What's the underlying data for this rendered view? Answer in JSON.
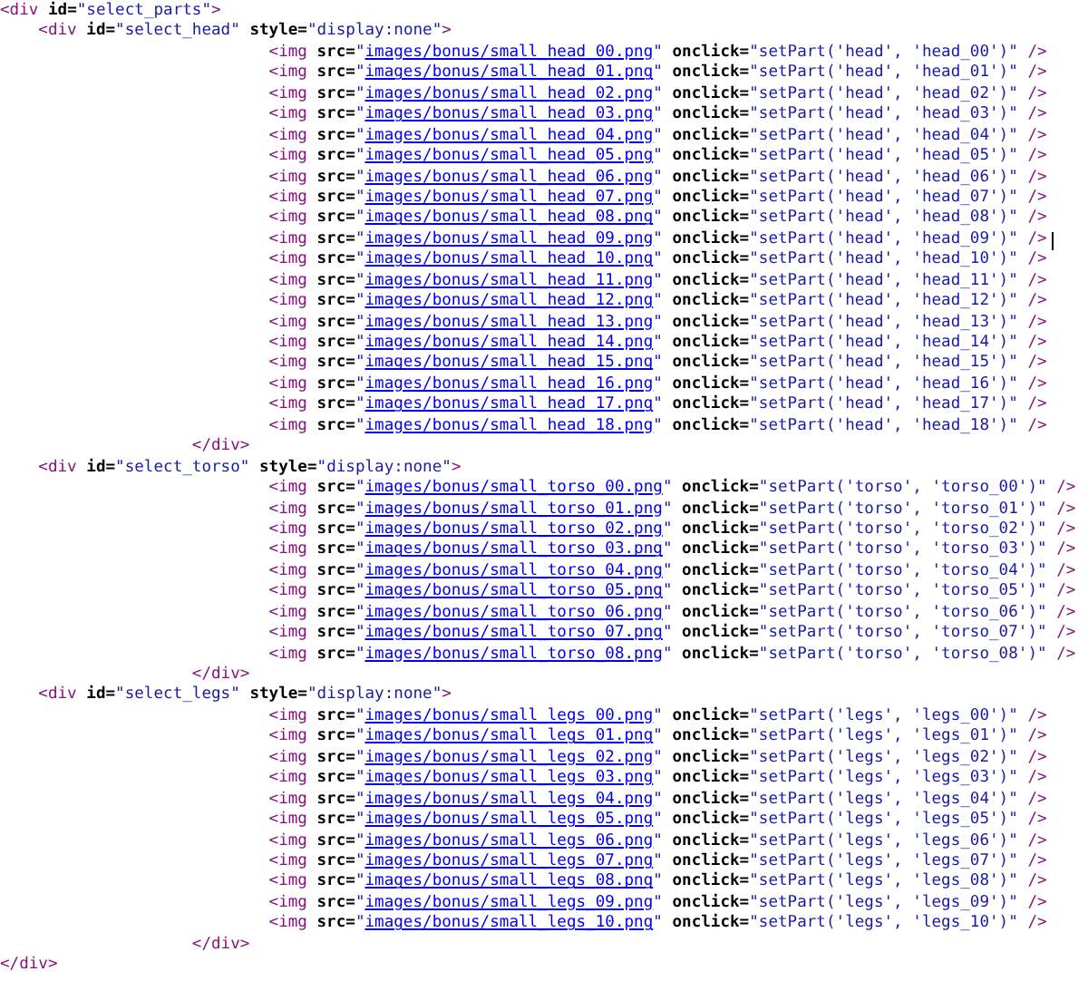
{
  "lines": [
    {
      "kind": "root-open",
      "caret": false,
      "tokens": [
        {
          "kind": "tag",
          "t": "<div"
        },
        {
          "kind": "attr",
          "t": " id="
        },
        {
          "kind": "val",
          "t": "\"select_parts\""
        },
        {
          "kind": "tag",
          "t": ">"
        }
      ]
    },
    {
      "kind": "group-open",
      "caret": false,
      "tokens": [
        {
          "kind": "tag",
          "t": "<div"
        },
        {
          "kind": "attr",
          "t": " id="
        },
        {
          "kind": "val",
          "t": "\"select_head\""
        },
        {
          "kind": "attr",
          "t": " style="
        },
        {
          "kind": "val",
          "t": "\"display:none\""
        },
        {
          "kind": "tag",
          "t": ">"
        }
      ]
    },
    {
      "kind": "img",
      "caret": false,
      "tokens": [
        {
          "kind": "tag",
          "t": "<img"
        },
        {
          "kind": "attr",
          "t": " src="
        },
        {
          "kind": "val",
          "t": "\""
        },
        {
          "kind": "link",
          "t": "images/bonus/small_head_00.png"
        },
        {
          "kind": "val",
          "t": "\""
        },
        {
          "kind": "attr",
          "t": " onclick="
        },
        {
          "kind": "val",
          "t": "\"setPart('head', 'head_00')\""
        },
        {
          "kind": "tag",
          "t": " />"
        }
      ]
    },
    {
      "kind": "img",
      "caret": false,
      "tokens": [
        {
          "kind": "tag",
          "t": "<img"
        },
        {
          "kind": "attr",
          "t": " src="
        },
        {
          "kind": "val",
          "t": "\""
        },
        {
          "kind": "link",
          "t": "images/bonus/small_head_01.png"
        },
        {
          "kind": "val",
          "t": "\""
        },
        {
          "kind": "attr",
          "t": " onclick="
        },
        {
          "kind": "val",
          "t": "\"setPart('head', 'head_01')\""
        },
        {
          "kind": "tag",
          "t": " />"
        }
      ]
    },
    {
      "kind": "img",
      "caret": false,
      "tokens": [
        {
          "kind": "tag",
          "t": "<img"
        },
        {
          "kind": "attr",
          "t": " src="
        },
        {
          "kind": "val",
          "t": "\""
        },
        {
          "kind": "link",
          "t": "images/bonus/small_head_02.png"
        },
        {
          "kind": "val",
          "t": "\""
        },
        {
          "kind": "attr",
          "t": " onclick="
        },
        {
          "kind": "val",
          "t": "\"setPart('head', 'head_02')\""
        },
        {
          "kind": "tag",
          "t": " />"
        }
      ]
    },
    {
      "kind": "img",
      "caret": false,
      "tokens": [
        {
          "kind": "tag",
          "t": "<img"
        },
        {
          "kind": "attr",
          "t": " src="
        },
        {
          "kind": "val",
          "t": "\""
        },
        {
          "kind": "link",
          "t": "images/bonus/small_head_03.png"
        },
        {
          "kind": "val",
          "t": "\""
        },
        {
          "kind": "attr",
          "t": " onclick="
        },
        {
          "kind": "val",
          "t": "\"setPart('head', 'head_03')\""
        },
        {
          "kind": "tag",
          "t": " />"
        }
      ]
    },
    {
      "kind": "img",
      "caret": false,
      "tokens": [
        {
          "kind": "tag",
          "t": "<img"
        },
        {
          "kind": "attr",
          "t": " src="
        },
        {
          "kind": "val",
          "t": "\""
        },
        {
          "kind": "link",
          "t": "images/bonus/small_head_04.png"
        },
        {
          "kind": "val",
          "t": "\""
        },
        {
          "kind": "attr",
          "t": " onclick="
        },
        {
          "kind": "val",
          "t": "\"setPart('head', 'head_04')\""
        },
        {
          "kind": "tag",
          "t": " />"
        }
      ]
    },
    {
      "kind": "img",
      "caret": false,
      "tokens": [
        {
          "kind": "tag",
          "t": "<img"
        },
        {
          "kind": "attr",
          "t": " src="
        },
        {
          "kind": "val",
          "t": "\""
        },
        {
          "kind": "link",
          "t": "images/bonus/small_head_05.png"
        },
        {
          "kind": "val",
          "t": "\""
        },
        {
          "kind": "attr",
          "t": " onclick="
        },
        {
          "kind": "val",
          "t": "\"setPart('head', 'head_05')\""
        },
        {
          "kind": "tag",
          "t": " />"
        }
      ]
    },
    {
      "kind": "img",
      "caret": false,
      "tokens": [
        {
          "kind": "tag",
          "t": "<img"
        },
        {
          "kind": "attr",
          "t": " src="
        },
        {
          "kind": "val",
          "t": "\""
        },
        {
          "kind": "link",
          "t": "images/bonus/small_head_06.png"
        },
        {
          "kind": "val",
          "t": "\""
        },
        {
          "kind": "attr",
          "t": " onclick="
        },
        {
          "kind": "val",
          "t": "\"setPart('head', 'head_06')\""
        },
        {
          "kind": "tag",
          "t": " />"
        }
      ]
    },
    {
      "kind": "img",
      "caret": false,
      "tokens": [
        {
          "kind": "tag",
          "t": "<img"
        },
        {
          "kind": "attr",
          "t": " src="
        },
        {
          "kind": "val",
          "t": "\""
        },
        {
          "kind": "link",
          "t": "images/bonus/small_head_07.png"
        },
        {
          "kind": "val",
          "t": "\""
        },
        {
          "kind": "attr",
          "t": " onclick="
        },
        {
          "kind": "val",
          "t": "\"setPart('head', 'head_07')\""
        },
        {
          "kind": "tag",
          "t": " />"
        }
      ]
    },
    {
      "kind": "img",
      "caret": false,
      "tokens": [
        {
          "kind": "tag",
          "t": "<img"
        },
        {
          "kind": "attr",
          "t": " src="
        },
        {
          "kind": "val",
          "t": "\""
        },
        {
          "kind": "link",
          "t": "images/bonus/small_head_08.png"
        },
        {
          "kind": "val",
          "t": "\""
        },
        {
          "kind": "attr",
          "t": " onclick="
        },
        {
          "kind": "val",
          "t": "\"setPart('head', 'head_08')\""
        },
        {
          "kind": "tag",
          "t": " />"
        }
      ]
    },
    {
      "kind": "img",
      "caret": true,
      "tokens": [
        {
          "kind": "tag",
          "t": "<img"
        },
        {
          "kind": "attr",
          "t": " src="
        },
        {
          "kind": "val",
          "t": "\""
        },
        {
          "kind": "link",
          "t": "images/bonus/small_head_09.png"
        },
        {
          "kind": "val",
          "t": "\""
        },
        {
          "kind": "attr",
          "t": " onclick="
        },
        {
          "kind": "val",
          "t": "\"setPart('head', 'head_09')\""
        },
        {
          "kind": "tag",
          "t": " />"
        }
      ]
    },
    {
      "kind": "img",
      "caret": false,
      "tokens": [
        {
          "kind": "tag",
          "t": "<img"
        },
        {
          "kind": "attr",
          "t": " src="
        },
        {
          "kind": "val",
          "t": "\""
        },
        {
          "kind": "link",
          "t": "images/bonus/small_head_10.png"
        },
        {
          "kind": "val",
          "t": "\""
        },
        {
          "kind": "attr",
          "t": " onclick="
        },
        {
          "kind": "val",
          "t": "\"setPart('head', 'head_10')\""
        },
        {
          "kind": "tag",
          "t": " />"
        }
      ]
    },
    {
      "kind": "img",
      "caret": false,
      "tokens": [
        {
          "kind": "tag",
          "t": "<img"
        },
        {
          "kind": "attr",
          "t": " src="
        },
        {
          "kind": "val",
          "t": "\""
        },
        {
          "kind": "link",
          "t": "images/bonus/small_head_11.png"
        },
        {
          "kind": "val",
          "t": "\""
        },
        {
          "kind": "attr",
          "t": " onclick="
        },
        {
          "kind": "val",
          "t": "\"setPart('head', 'head_11')\""
        },
        {
          "kind": "tag",
          "t": " />"
        }
      ]
    },
    {
      "kind": "img",
      "caret": false,
      "tokens": [
        {
          "kind": "tag",
          "t": "<img"
        },
        {
          "kind": "attr",
          "t": " src="
        },
        {
          "kind": "val",
          "t": "\""
        },
        {
          "kind": "link",
          "t": "images/bonus/small_head_12.png"
        },
        {
          "kind": "val",
          "t": "\""
        },
        {
          "kind": "attr",
          "t": " onclick="
        },
        {
          "kind": "val",
          "t": "\"setPart('head', 'head_12')\""
        },
        {
          "kind": "tag",
          "t": " />"
        }
      ]
    },
    {
      "kind": "img",
      "caret": false,
      "tokens": [
        {
          "kind": "tag",
          "t": "<img"
        },
        {
          "kind": "attr",
          "t": " src="
        },
        {
          "kind": "val",
          "t": "\""
        },
        {
          "kind": "link",
          "t": "images/bonus/small_head_13.png"
        },
        {
          "kind": "val",
          "t": "\""
        },
        {
          "kind": "attr",
          "t": " onclick="
        },
        {
          "kind": "val",
          "t": "\"setPart('head', 'head_13')\""
        },
        {
          "kind": "tag",
          "t": " />"
        }
      ]
    },
    {
      "kind": "img",
      "caret": false,
      "tokens": [
        {
          "kind": "tag",
          "t": "<img"
        },
        {
          "kind": "attr",
          "t": " src="
        },
        {
          "kind": "val",
          "t": "\""
        },
        {
          "kind": "link",
          "t": "images/bonus/small_head_14.png"
        },
        {
          "kind": "val",
          "t": "\""
        },
        {
          "kind": "attr",
          "t": " onclick="
        },
        {
          "kind": "val",
          "t": "\"setPart('head', 'head_14')\""
        },
        {
          "kind": "tag",
          "t": " />"
        }
      ]
    },
    {
      "kind": "img",
      "caret": false,
      "tokens": [
        {
          "kind": "tag",
          "t": "<img"
        },
        {
          "kind": "attr",
          "t": " src="
        },
        {
          "kind": "val",
          "t": "\""
        },
        {
          "kind": "link",
          "t": "images/bonus/small_head_15.png"
        },
        {
          "kind": "val",
          "t": "\""
        },
        {
          "kind": "attr",
          "t": " onclick="
        },
        {
          "kind": "val",
          "t": "\"setPart('head', 'head_15')\""
        },
        {
          "kind": "tag",
          "t": " />"
        }
      ]
    },
    {
      "kind": "img",
      "caret": false,
      "tokens": [
        {
          "kind": "tag",
          "t": "<img"
        },
        {
          "kind": "attr",
          "t": " src="
        },
        {
          "kind": "val",
          "t": "\""
        },
        {
          "kind": "link",
          "t": "images/bonus/small_head_16.png"
        },
        {
          "kind": "val",
          "t": "\""
        },
        {
          "kind": "attr",
          "t": " onclick="
        },
        {
          "kind": "val",
          "t": "\"setPart('head', 'head_16')\""
        },
        {
          "kind": "tag",
          "t": " />"
        }
      ]
    },
    {
      "kind": "img",
      "caret": false,
      "tokens": [
        {
          "kind": "tag",
          "t": "<img"
        },
        {
          "kind": "attr",
          "t": " src="
        },
        {
          "kind": "val",
          "t": "\""
        },
        {
          "kind": "link",
          "t": "images/bonus/small_head_17.png"
        },
        {
          "kind": "val",
          "t": "\""
        },
        {
          "kind": "attr",
          "t": " onclick="
        },
        {
          "kind": "val",
          "t": "\"setPart('head', 'head_17')\""
        },
        {
          "kind": "tag",
          "t": " />"
        }
      ]
    },
    {
      "kind": "img",
      "caret": false,
      "tokens": [
        {
          "kind": "tag",
          "t": "<img"
        },
        {
          "kind": "attr",
          "t": " src="
        },
        {
          "kind": "val",
          "t": "\""
        },
        {
          "kind": "link",
          "t": "images/bonus/small_head_18.png"
        },
        {
          "kind": "val",
          "t": "\""
        },
        {
          "kind": "attr",
          "t": " onclick="
        },
        {
          "kind": "val",
          "t": "\"setPart('head', 'head_18')\""
        },
        {
          "kind": "tag",
          "t": " />"
        }
      ]
    },
    {
      "kind": "group-close",
      "caret": false,
      "tokens": [
        {
          "kind": "tag",
          "t": "</div>"
        }
      ]
    },
    {
      "kind": "group-open",
      "caret": false,
      "tokens": [
        {
          "kind": "tag",
          "t": "<div"
        },
        {
          "kind": "attr",
          "t": " id="
        },
        {
          "kind": "val",
          "t": "\"select_torso\""
        },
        {
          "kind": "attr",
          "t": " style="
        },
        {
          "kind": "val",
          "t": "\"display:none\""
        },
        {
          "kind": "tag",
          "t": ">"
        }
      ]
    },
    {
      "kind": "img",
      "caret": false,
      "tokens": [
        {
          "kind": "tag",
          "t": "<img"
        },
        {
          "kind": "attr",
          "t": " src="
        },
        {
          "kind": "val",
          "t": "\""
        },
        {
          "kind": "link",
          "t": "images/bonus/small_torso_00.png"
        },
        {
          "kind": "val",
          "t": "\""
        },
        {
          "kind": "attr",
          "t": " onclick="
        },
        {
          "kind": "val",
          "t": "\"setPart('torso', 'torso_00')\""
        },
        {
          "kind": "tag",
          "t": " />"
        }
      ]
    },
    {
      "kind": "img",
      "caret": false,
      "tokens": [
        {
          "kind": "tag",
          "t": "<img"
        },
        {
          "kind": "attr",
          "t": " src="
        },
        {
          "kind": "val",
          "t": "\""
        },
        {
          "kind": "link",
          "t": "images/bonus/small_torso_01.png"
        },
        {
          "kind": "val",
          "t": "\""
        },
        {
          "kind": "attr",
          "t": " onclick="
        },
        {
          "kind": "val",
          "t": "\"setPart('torso', 'torso_01')\""
        },
        {
          "kind": "tag",
          "t": " />"
        }
      ]
    },
    {
      "kind": "img",
      "caret": false,
      "tokens": [
        {
          "kind": "tag",
          "t": "<img"
        },
        {
          "kind": "attr",
          "t": " src="
        },
        {
          "kind": "val",
          "t": "\""
        },
        {
          "kind": "link",
          "t": "images/bonus/small_torso_02.png"
        },
        {
          "kind": "val",
          "t": "\""
        },
        {
          "kind": "attr",
          "t": " onclick="
        },
        {
          "kind": "val",
          "t": "\"setPart('torso', 'torso_02')\""
        },
        {
          "kind": "tag",
          "t": " />"
        }
      ]
    },
    {
      "kind": "img",
      "caret": false,
      "tokens": [
        {
          "kind": "tag",
          "t": "<img"
        },
        {
          "kind": "attr",
          "t": " src="
        },
        {
          "kind": "val",
          "t": "\""
        },
        {
          "kind": "link",
          "t": "images/bonus/small_torso_03.png"
        },
        {
          "kind": "val",
          "t": "\""
        },
        {
          "kind": "attr",
          "t": " onclick="
        },
        {
          "kind": "val",
          "t": "\"setPart('torso', 'torso_03')\""
        },
        {
          "kind": "tag",
          "t": " />"
        }
      ]
    },
    {
      "kind": "img",
      "caret": false,
      "tokens": [
        {
          "kind": "tag",
          "t": "<img"
        },
        {
          "kind": "attr",
          "t": " src="
        },
        {
          "kind": "val",
          "t": "\""
        },
        {
          "kind": "link",
          "t": "images/bonus/small_torso_04.png"
        },
        {
          "kind": "val",
          "t": "\""
        },
        {
          "kind": "attr",
          "t": " onclick="
        },
        {
          "kind": "val",
          "t": "\"setPart('torso', 'torso_04')\""
        },
        {
          "kind": "tag",
          "t": " />"
        }
      ]
    },
    {
      "kind": "img",
      "caret": false,
      "tokens": [
        {
          "kind": "tag",
          "t": "<img"
        },
        {
          "kind": "attr",
          "t": " src="
        },
        {
          "kind": "val",
          "t": "\""
        },
        {
          "kind": "link",
          "t": "images/bonus/small_torso_05.png"
        },
        {
          "kind": "val",
          "t": "\""
        },
        {
          "kind": "attr",
          "t": " onclick="
        },
        {
          "kind": "val",
          "t": "\"setPart('torso', 'torso_05')\""
        },
        {
          "kind": "tag",
          "t": " />"
        }
      ]
    },
    {
      "kind": "img",
      "caret": false,
      "tokens": [
        {
          "kind": "tag",
          "t": "<img"
        },
        {
          "kind": "attr",
          "t": " src="
        },
        {
          "kind": "val",
          "t": "\""
        },
        {
          "kind": "link",
          "t": "images/bonus/small_torso_06.png"
        },
        {
          "kind": "val",
          "t": "\""
        },
        {
          "kind": "attr",
          "t": " onclick="
        },
        {
          "kind": "val",
          "t": "\"setPart('torso', 'torso_06')\""
        },
        {
          "kind": "tag",
          "t": " />"
        }
      ]
    },
    {
      "kind": "img",
      "caret": false,
      "tokens": [
        {
          "kind": "tag",
          "t": "<img"
        },
        {
          "kind": "attr",
          "t": " src="
        },
        {
          "kind": "val",
          "t": "\""
        },
        {
          "kind": "link",
          "t": "images/bonus/small_torso_07.png"
        },
        {
          "kind": "val",
          "t": "\""
        },
        {
          "kind": "attr",
          "t": " onclick="
        },
        {
          "kind": "val",
          "t": "\"setPart('torso', 'torso_07')\""
        },
        {
          "kind": "tag",
          "t": " />"
        }
      ]
    },
    {
      "kind": "img",
      "caret": false,
      "tokens": [
        {
          "kind": "tag",
          "t": "<img"
        },
        {
          "kind": "attr",
          "t": " src="
        },
        {
          "kind": "val",
          "t": "\""
        },
        {
          "kind": "link",
          "t": "images/bonus/small_torso_08.png"
        },
        {
          "kind": "val",
          "t": "\""
        },
        {
          "kind": "attr",
          "t": " onclick="
        },
        {
          "kind": "val",
          "t": "\"setPart('torso', 'torso_08')\""
        },
        {
          "kind": "tag",
          "t": " />"
        }
      ]
    },
    {
      "kind": "group-close",
      "caret": false,
      "tokens": [
        {
          "kind": "tag",
          "t": "</div>"
        }
      ]
    },
    {
      "kind": "group-open",
      "caret": false,
      "tokens": [
        {
          "kind": "tag",
          "t": "<div"
        },
        {
          "kind": "attr",
          "t": " id="
        },
        {
          "kind": "val",
          "t": "\"select_legs\""
        },
        {
          "kind": "attr",
          "t": " style="
        },
        {
          "kind": "val",
          "t": "\"display:none\""
        },
        {
          "kind": "tag",
          "t": ">"
        }
      ]
    },
    {
      "kind": "img",
      "caret": false,
      "tokens": [
        {
          "kind": "tag",
          "t": "<img"
        },
        {
          "kind": "attr",
          "t": " src="
        },
        {
          "kind": "val",
          "t": "\""
        },
        {
          "kind": "link",
          "t": "images/bonus/small_legs_00.png"
        },
        {
          "kind": "val",
          "t": "\""
        },
        {
          "kind": "attr",
          "t": " onclick="
        },
        {
          "kind": "val",
          "t": "\"setPart('legs', 'legs_00')\""
        },
        {
          "kind": "tag",
          "t": " />"
        }
      ]
    },
    {
      "kind": "img",
      "caret": false,
      "tokens": [
        {
          "kind": "tag",
          "t": "<img"
        },
        {
          "kind": "attr",
          "t": " src="
        },
        {
          "kind": "val",
          "t": "\""
        },
        {
          "kind": "link",
          "t": "images/bonus/small_legs_01.png"
        },
        {
          "kind": "val",
          "t": "\""
        },
        {
          "kind": "attr",
          "t": " onclick="
        },
        {
          "kind": "val",
          "t": "\"setPart('legs', 'legs_01')\""
        },
        {
          "kind": "tag",
          "t": " />"
        }
      ]
    },
    {
      "kind": "img",
      "caret": false,
      "tokens": [
        {
          "kind": "tag",
          "t": "<img"
        },
        {
          "kind": "attr",
          "t": " src="
        },
        {
          "kind": "val",
          "t": "\""
        },
        {
          "kind": "link",
          "t": "images/bonus/small_legs_02.png"
        },
        {
          "kind": "val",
          "t": "\""
        },
        {
          "kind": "attr",
          "t": " onclick="
        },
        {
          "kind": "val",
          "t": "\"setPart('legs', 'legs_02')\""
        },
        {
          "kind": "tag",
          "t": " />"
        }
      ]
    },
    {
      "kind": "img",
      "caret": false,
      "tokens": [
        {
          "kind": "tag",
          "t": "<img"
        },
        {
          "kind": "attr",
          "t": " src="
        },
        {
          "kind": "val",
          "t": "\""
        },
        {
          "kind": "link",
          "t": "images/bonus/small_legs_03.png"
        },
        {
          "kind": "val",
          "t": "\""
        },
        {
          "kind": "attr",
          "t": " onclick="
        },
        {
          "kind": "val",
          "t": "\"setPart('legs', 'legs_03')\""
        },
        {
          "kind": "tag",
          "t": " />"
        }
      ]
    },
    {
      "kind": "img",
      "caret": false,
      "tokens": [
        {
          "kind": "tag",
          "t": "<img"
        },
        {
          "kind": "attr",
          "t": " src="
        },
        {
          "kind": "val",
          "t": "\""
        },
        {
          "kind": "link",
          "t": "images/bonus/small_legs_04.png"
        },
        {
          "kind": "val",
          "t": "\""
        },
        {
          "kind": "attr",
          "t": " onclick="
        },
        {
          "kind": "val",
          "t": "\"setPart('legs', 'legs_04')\""
        },
        {
          "kind": "tag",
          "t": " />"
        }
      ]
    },
    {
      "kind": "img",
      "caret": false,
      "tokens": [
        {
          "kind": "tag",
          "t": "<img"
        },
        {
          "kind": "attr",
          "t": " src="
        },
        {
          "kind": "val",
          "t": "\""
        },
        {
          "kind": "link",
          "t": "images/bonus/small_legs_05.png"
        },
        {
          "kind": "val",
          "t": "\""
        },
        {
          "kind": "attr",
          "t": " onclick="
        },
        {
          "kind": "val",
          "t": "\"setPart('legs', 'legs_05')\""
        },
        {
          "kind": "tag",
          "t": " />"
        }
      ]
    },
    {
      "kind": "img",
      "caret": false,
      "tokens": [
        {
          "kind": "tag",
          "t": "<img"
        },
        {
          "kind": "attr",
          "t": " src="
        },
        {
          "kind": "val",
          "t": "\""
        },
        {
          "kind": "link",
          "t": "images/bonus/small_legs_06.png"
        },
        {
          "kind": "val",
          "t": "\""
        },
        {
          "kind": "attr",
          "t": " onclick="
        },
        {
          "kind": "val",
          "t": "\"setPart('legs', 'legs_06')\""
        },
        {
          "kind": "tag",
          "t": " />"
        }
      ]
    },
    {
      "kind": "img",
      "caret": false,
      "tokens": [
        {
          "kind": "tag",
          "t": "<img"
        },
        {
          "kind": "attr",
          "t": " src="
        },
        {
          "kind": "val",
          "t": "\""
        },
        {
          "kind": "link",
          "t": "images/bonus/small_legs_07.png"
        },
        {
          "kind": "val",
          "t": "\""
        },
        {
          "kind": "attr",
          "t": " onclick="
        },
        {
          "kind": "val",
          "t": "\"setPart('legs', 'legs_07')\""
        },
        {
          "kind": "tag",
          "t": " />"
        }
      ]
    },
    {
      "kind": "img",
      "caret": false,
      "tokens": [
        {
          "kind": "tag",
          "t": "<img"
        },
        {
          "kind": "attr",
          "t": " src="
        },
        {
          "kind": "val",
          "t": "\""
        },
        {
          "kind": "link",
          "t": "images/bonus/small_legs_08.png"
        },
        {
          "kind": "val",
          "t": "\""
        },
        {
          "kind": "attr",
          "t": " onclick="
        },
        {
          "kind": "val",
          "t": "\"setPart('legs', 'legs_08')\""
        },
        {
          "kind": "tag",
          "t": " />"
        }
      ]
    },
    {
      "kind": "img",
      "caret": false,
      "tokens": [
        {
          "kind": "tag",
          "t": "<img"
        },
        {
          "kind": "attr",
          "t": " src="
        },
        {
          "kind": "val",
          "t": "\""
        },
        {
          "kind": "link",
          "t": "images/bonus/small_legs_09.png"
        },
        {
          "kind": "val",
          "t": "\""
        },
        {
          "kind": "attr",
          "t": " onclick="
        },
        {
          "kind": "val",
          "t": "\"setPart('legs', 'legs_09')\""
        },
        {
          "kind": "tag",
          "t": " />"
        }
      ]
    },
    {
      "kind": "img",
      "caret": false,
      "tokens": [
        {
          "kind": "tag",
          "t": "<img"
        },
        {
          "kind": "attr",
          "t": " src="
        },
        {
          "kind": "val",
          "t": "\""
        },
        {
          "kind": "link",
          "t": "images/bonus/small_legs_10.png"
        },
        {
          "kind": "val",
          "t": "\""
        },
        {
          "kind": "attr",
          "t": " onclick="
        },
        {
          "kind": "val",
          "t": "\"setPart('legs', 'legs_10')\""
        },
        {
          "kind": "tag",
          "t": " />"
        }
      ]
    },
    {
      "kind": "group-close",
      "caret": false,
      "tokens": [
        {
          "kind": "tag",
          "t": "</div>"
        }
      ]
    },
    {
      "kind": "root-close",
      "caret": false,
      "tokens": [
        {
          "kind": "tag",
          "t": "</div>"
        }
      ]
    }
  ]
}
